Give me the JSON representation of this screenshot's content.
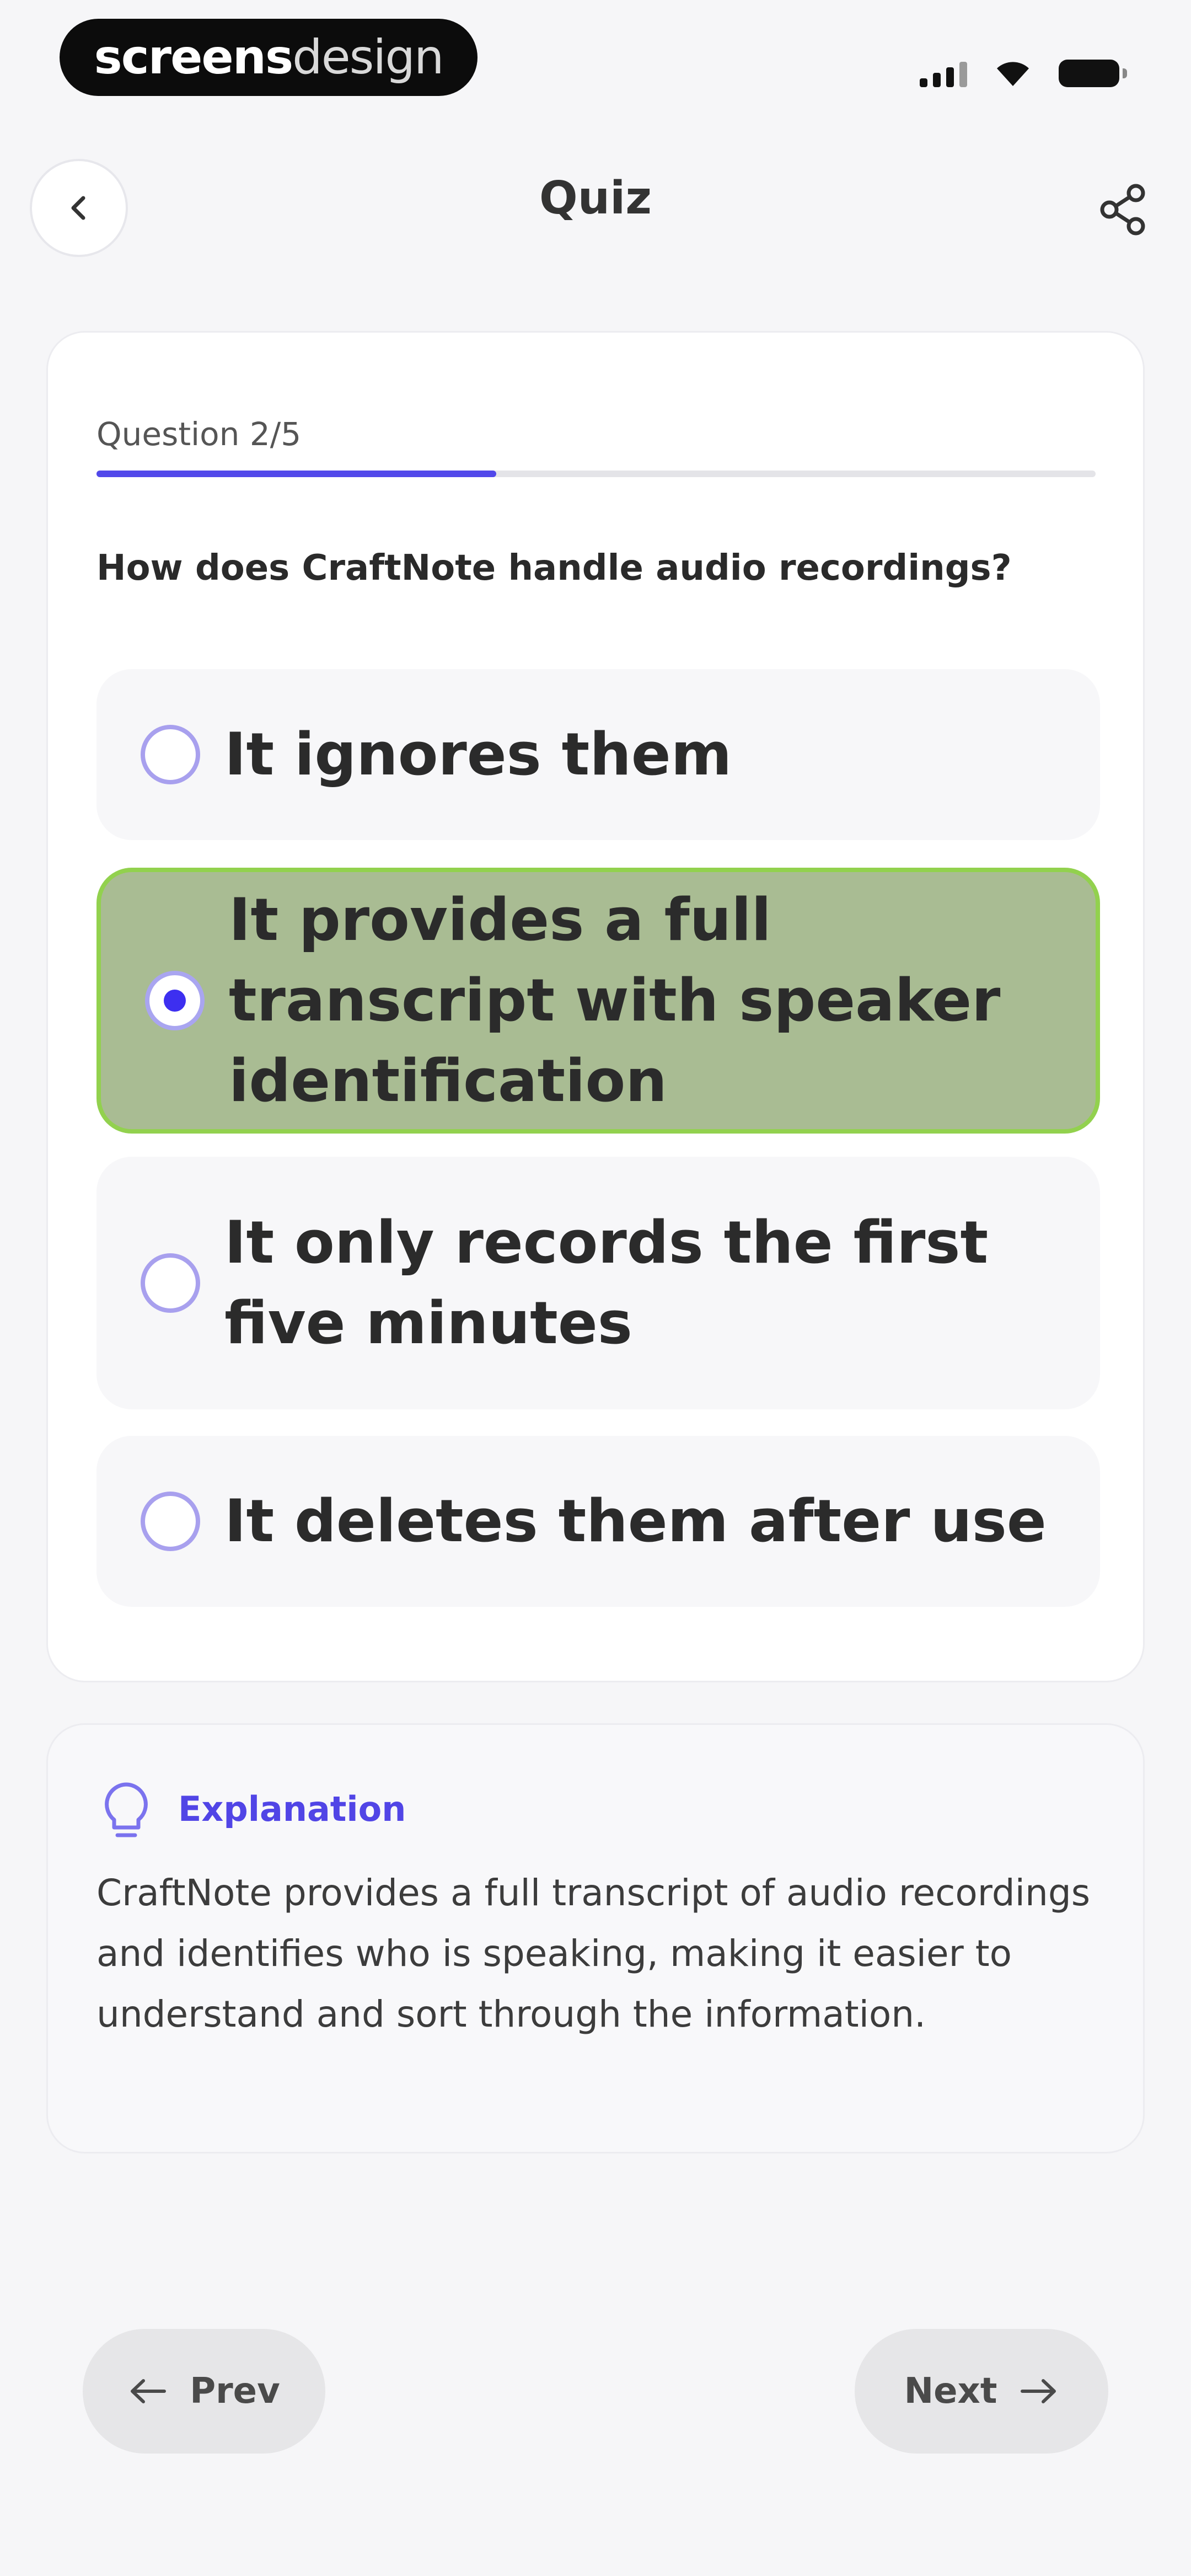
{
  "status_bar": {
    "brand_bold": "screens",
    "brand_light": "design"
  },
  "header": {
    "title": "Quiz",
    "back_icon": "chevron-left-icon",
    "share_icon": "share-icon"
  },
  "quiz": {
    "question_counter": "Question 2/5",
    "progress": 0.4,
    "question": "How does CraftNote handle audio recordings?",
    "options": [
      {
        "label": "It ignores them",
        "selected": false
      },
      {
        "label": "It provides a full transcript with speaker identification",
        "selected": true
      },
      {
        "label": "It only records the first five minutes",
        "selected": false
      },
      {
        "label": "It deletes them after use",
        "selected": false
      }
    ]
  },
  "explanation": {
    "icon": "lightbulb-icon",
    "title": "Explanation",
    "text": "CraftNote provides a full transcript of audio recordings and identifies who is speaking, making it easier to understand and sort through the information."
  },
  "navigation": {
    "prev_label": "Prev",
    "next_label": "Next",
    "prev_icon": "arrow-left-icon",
    "next_icon": "arrow-right-icon"
  },
  "colors": {
    "accent": "#5148ea",
    "selected_bg": "#a9bc93",
    "selected_border": "#92d14e"
  }
}
